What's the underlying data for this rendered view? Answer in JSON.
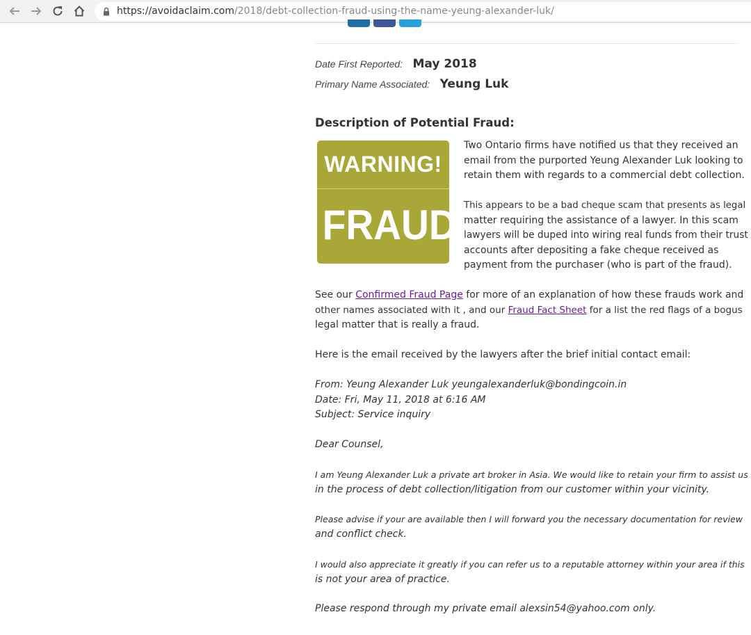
{
  "browser": {
    "url_host": "https://avoidaclaim.com",
    "url_path": "/2018/debt-collection-fraud-using-the-name-yeung-alexander-luk/"
  },
  "meta": {
    "date_label": "Date First Reported:",
    "date_value": "May 2018",
    "name_label": "Primary Name Associated:",
    "name_value": "Yeung Luk"
  },
  "description_title": "Description of Potential Fraud:",
  "warning_image": {
    "top_text": "WARNING!",
    "bottom_text": "FRAUD",
    "color": "#a9a738"
  },
  "intro_paragraph": [
    "Two Ontario firms have notified us that they received an",
    "email from the purported Yeung Alexander Luk looking to",
    "retain them with regards to a commercial debt collection."
  ],
  "scam_paragraph": [
    "This appears to be a bad cheque scam that presents as legal",
    "matter requiring the assistance of a lawyer. In this scam",
    "lawyers will be duped into wiring real funds from their trust",
    "accounts after depositing a fake cheque received as",
    "payment from the purchaser (who is part of the fraud)."
  ],
  "see_our": {
    "prefix": "See our ",
    "link1": "Confirmed Fraud Page",
    "middle1": " for more of an explanation of how these frauds work and",
    "middle2": "other names associated with it , and our ",
    "link2": "Fraud Fact Sheet",
    "suffix": " for a list the red flags of a bogus",
    "line3": "legal matter that is really a fraud."
  },
  "email_intro": "Here is the email received by the lawyers after the brief initial contact email:",
  "email_headers": {
    "from": "From: Yeung Alexander Luk yeungalexanderluk@bondingcoin.in",
    "date": "Date: Fri, May 11, 2018 at 6:16 AM",
    "subject": "Subject: Service inquiry"
  },
  "email_greeting": "Dear Counsel,",
  "email_p1": [
    "I am Yeung Alexander Luk a private art broker in Asia. We would like to retain your firm to assist us",
    "in the process of debt collection/litigation from our customer within your vicinity."
  ],
  "email_p2": [
    "Please advise if your are available then I will forward you the necessary documentation for review",
    "and conflict check."
  ],
  "email_p3": [
    "I would also appreciate it greatly if you can refer us to a reputable attorney within your area if this",
    "is not your area of practice."
  ],
  "email_p4": "Please respond through my private email alexsin54@yahoo.com only."
}
